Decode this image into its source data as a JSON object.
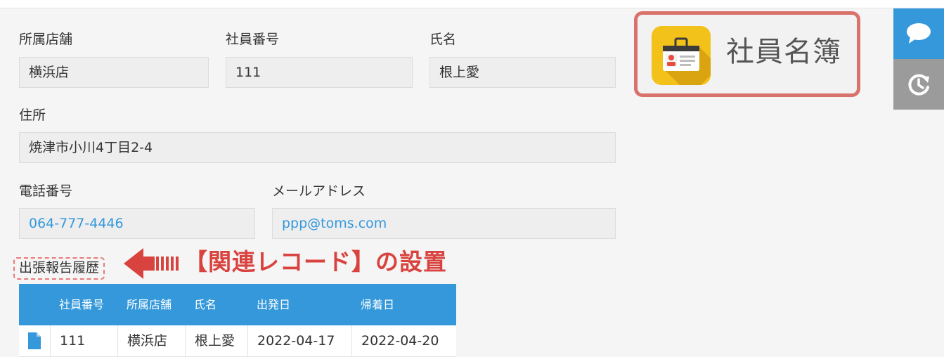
{
  "form": {
    "store": {
      "label": "所属店舗",
      "value": "横浜店"
    },
    "employee_no": {
      "label": "社員番号",
      "value": "111"
    },
    "name": {
      "label": "氏名",
      "value": "根上愛"
    },
    "address": {
      "label": "住所",
      "value": "焼津市小川4丁目2-4"
    },
    "phone": {
      "label": "電話番号",
      "value": "064-777-4446"
    },
    "email": {
      "label": "メールアドレス",
      "value": "ppp@toms.com"
    }
  },
  "app": {
    "title": "社員名簿",
    "icon": "employee-id-card-icon"
  },
  "side_buttons": [
    {
      "name": "comment",
      "icon": "speech-bubble-icon"
    },
    {
      "name": "history",
      "icon": "history-icon"
    }
  ],
  "related_records": {
    "label": "出張報告履歴",
    "annotation": "【関連レコード】の設置",
    "columns": [
      "社員番号",
      "所属店舗",
      "氏名",
      "出発日",
      "帰着日"
    ],
    "rows": [
      {
        "cells": [
          "111",
          "横浜店",
          "根上愛",
          "2022-04-17",
          "2022-04-20"
        ]
      }
    ]
  },
  "colors": {
    "accent": "#3498db",
    "annotation": "#d9433f",
    "badge_border": "#d9726b",
    "icon_yellow": "#f2c21b"
  }
}
